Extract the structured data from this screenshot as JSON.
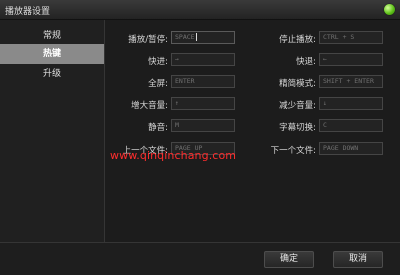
{
  "window": {
    "title": "播放器设置"
  },
  "sidebar": {
    "items": [
      {
        "label": "常规",
        "active": false
      },
      {
        "label": "热键",
        "active": true
      },
      {
        "label": "升级",
        "active": false
      }
    ]
  },
  "hotkeys": {
    "play_pause": {
      "label": "播放/暂停:",
      "value": "SPACE"
    },
    "stop": {
      "label": "停止播放:",
      "value": "CTRL + S"
    },
    "forward": {
      "label": "快进:",
      "value": "→"
    },
    "rewind": {
      "label": "快退:",
      "value": "←"
    },
    "fullscreen": {
      "label": "全屏:",
      "value": "ENTER"
    },
    "compact_mode": {
      "label": "精简模式:",
      "value": "SHIFT + ENTER"
    },
    "volume_up": {
      "label": "增大音量:",
      "value": "↑"
    },
    "volume_down": {
      "label": "减少音量:",
      "value": "↓"
    },
    "mute": {
      "label": "静音:",
      "value": "M"
    },
    "subtitle_switch": {
      "label": "字幕切换:",
      "value": "C"
    },
    "prev_file": {
      "label": "上一个文件:",
      "value": "PAGE UP"
    },
    "next_file": {
      "label": "下一个文件:",
      "value": "PAGE DOWN"
    }
  },
  "watermark": "www.qinqinchang.com",
  "footer": {
    "ok_label": "确定",
    "cancel_label": "取消"
  },
  "colors": {
    "status_dot": "#5fc21a",
    "active_tab": "#8a8a8a",
    "watermark": "#ff2d2d"
  }
}
